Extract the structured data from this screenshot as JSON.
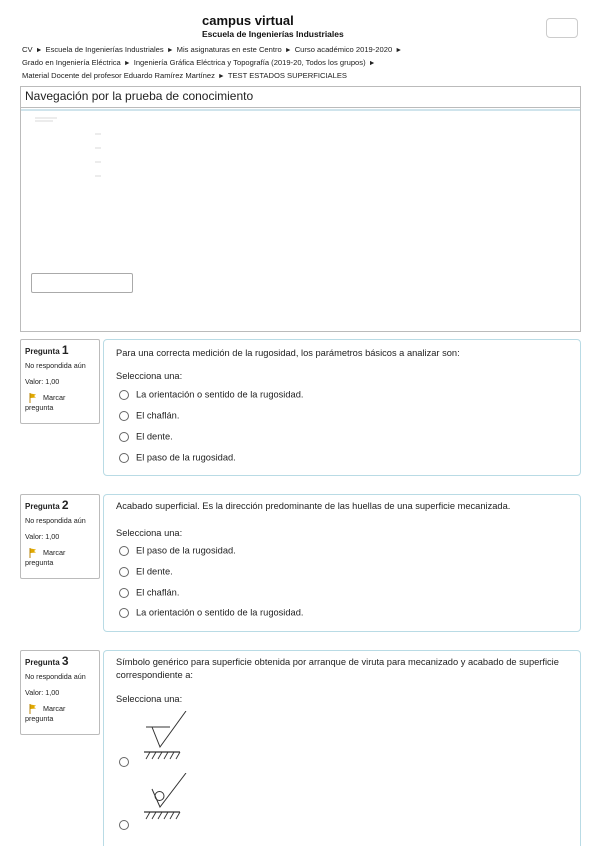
{
  "header": {
    "title": "campus virtual",
    "subtitle": "Escuela de Ingenierías Industriales"
  },
  "breadcrumb": [
    "CV",
    "Escuela de Ingenierías Industriales",
    "Mis asignaturas en este Centro",
    "Curso académico 2019-2020",
    "Grado en Ingeniería Eléctrica",
    "Ingeniería Gráfica Eléctrica y Topografía (2019-20, Todos los grupos)",
    "Material Docente del profesor Eduardo Ramírez Martínez",
    "TEST ESTADOS SUPERFICIALES"
  ],
  "navigation": {
    "title": "Navegación por la prueba de conocimiento"
  },
  "questions": [
    {
      "label": "Pregunta",
      "number": "1",
      "state": "No respondida aún",
      "grade": "Valor: 1,00",
      "flag_text": "Marcar pregunta",
      "text": "Para una correcta medición de la rugosidad, los parámetros básicos a analizar son:",
      "prompt": "Selecciona una:",
      "options": [
        "La orientación o sentido de la rugosidad.",
        "El chaflán.",
        "El dente.",
        "El paso de la rugosidad."
      ]
    },
    {
      "label": "Pregunta",
      "number": "2",
      "state": "No respondida aún",
      "grade": "Valor: 1,00",
      "flag_text": "Marcar pregunta",
      "text": "Acabado superficial. Es la dirección predominante de las huellas de una superficie mecanizada.",
      "prompt": "Selecciona una:",
      "options": [
        "El paso de la rugosidad.",
        "El dente.",
        "El chaflán.",
        "La orientación o sentido de la rugosidad."
      ]
    },
    {
      "label": "Pregunta",
      "number": "3",
      "state": "No respondida aún",
      "grade": "Valor: 1,00",
      "flag_text": "Marcar pregunta",
      "text": "Símbolo genérico para superficie obtenida por arranque de viruta para mecanizado y acabado de superficie correspondiente a:",
      "prompt": "Selecciona una:",
      "options": [
        {
          "icon": "surface-symbol-machined-icon"
        },
        {
          "icon": "surface-symbol-no-removal-icon"
        }
      ]
    }
  ],
  "colors": {
    "card_border": "#b9dbe5",
    "flag": "#e0a800"
  }
}
